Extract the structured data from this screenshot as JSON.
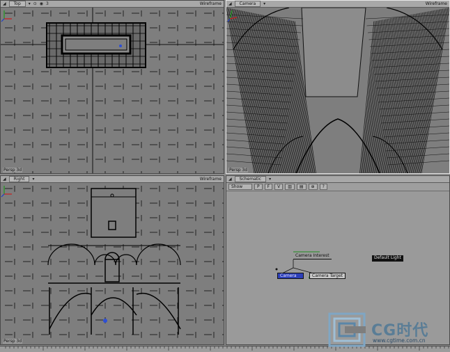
{
  "viewports": [
    {
      "id": "top",
      "label": "Top",
      "shading": "Wireframe",
      "icons": [
        "3"
      ],
      "active": false
    },
    {
      "id": "camera",
      "label": "Camera",
      "shading": "Wireframe",
      "icons": [],
      "active": true
    },
    {
      "id": "right",
      "label": "Right",
      "shading": "Wireframe",
      "icons": [],
      "active": false
    },
    {
      "id": "schematic",
      "label": "Schematic",
      "shading": "",
      "icons": [],
      "active": false
    }
  ],
  "persp_label": "Persp 3d",
  "schematic": {
    "toolbar": {
      "show_select": "Show",
      "buttons": [
        "P",
        "F",
        "V"
      ]
    },
    "nodes": {
      "parent": "Camera Interest",
      "child_selected": "Camera",
      "child_other": "Camera Target",
      "standalone": "Default Light"
    }
  },
  "timeline": {
    "ticks": [
      "",
      "",
      "",
      "",
      "",
      "",
      "",
      "",
      "",
      "",
      ""
    ]
  },
  "watermark": {
    "brand": "CG时代",
    "url": "www.cgtime.com.cn"
  },
  "colors": {
    "viewport_bg": "#7e7e7e",
    "wire": "#111111",
    "selected_node": "#2c3fb8",
    "axis_x": "#c81e1e",
    "axis_y": "#1e9a1e",
    "axis_z": "#1e3cc8"
  }
}
